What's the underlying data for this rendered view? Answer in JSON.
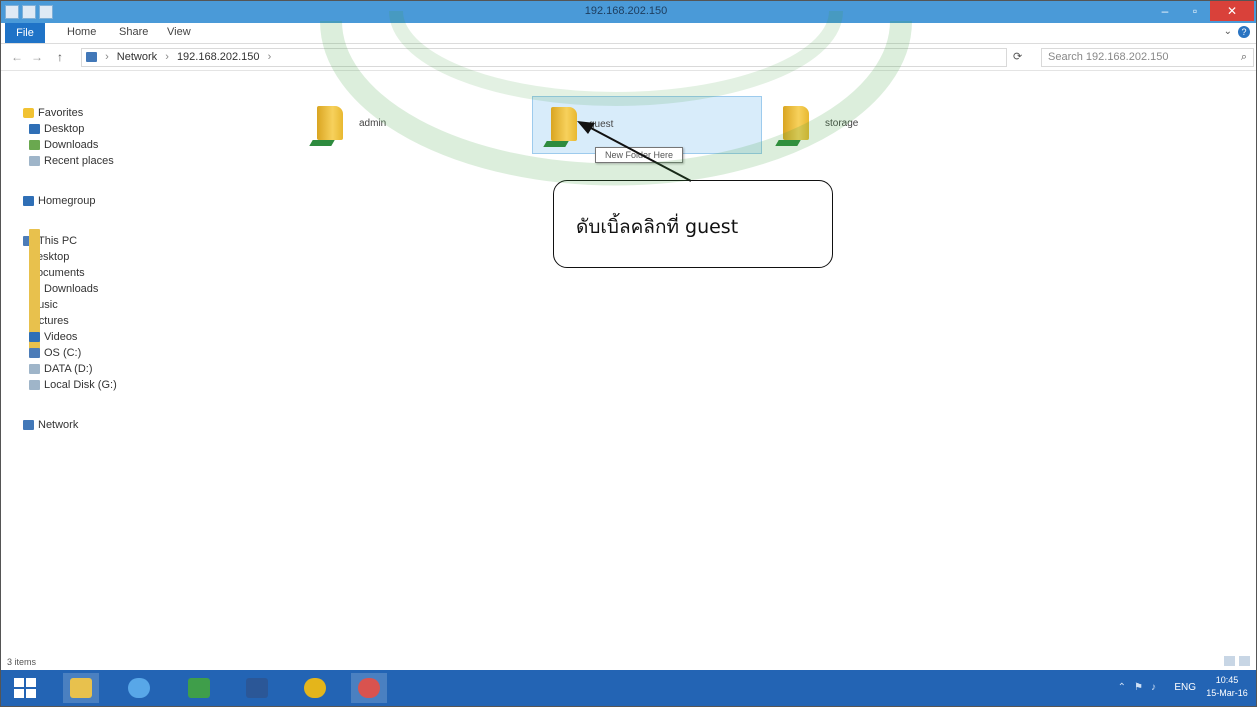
{
  "window": {
    "title": "192.168.202.150",
    "minimize_glyph": "–",
    "maximize_glyph": "▫",
    "close_glyph": "✕"
  },
  "ribbon": {
    "tabs": [
      "File",
      "Home",
      "Share",
      "View"
    ],
    "help_glyph": "?",
    "expand_glyph": "⌄"
  },
  "address_bar": {
    "back_glyph": "←",
    "forward_glyph": "→",
    "up_glyph": "↑",
    "path": [
      "Network",
      "192.168.202.150"
    ],
    "refresh_glyph": "⟳",
    "search_placeholder": "Search 192.168.202.150",
    "search_glyph": "⌕"
  },
  "nav_pane": {
    "favorites": {
      "label": "Favorites",
      "items": [
        "Desktop",
        "Downloads",
        "Recent places"
      ]
    },
    "homegroup": "Homegroup",
    "this_pc": {
      "label": "This PC",
      "items": [
        "Desktop",
        "Documents",
        "Downloads",
        "Music",
        "Pictures",
        "Videos",
        "OS (C:)",
        "DATA (D:)",
        "Local Disk (G:)"
      ]
    },
    "network": "Network"
  },
  "content": {
    "folders": [
      {
        "name": "admin",
        "selected": false
      },
      {
        "name": "guest",
        "selected": true
      },
      {
        "name": "storage",
        "selected": false
      }
    ],
    "tooltip": "New Folder Here"
  },
  "callout": {
    "text": "ดับเบิ้ลคลิกที่  guest"
  },
  "status_bar": {
    "item_count": "3 items"
  },
  "taskbar": {
    "tray_glyphs": [
      "⌃",
      "⚑",
      "♪"
    ],
    "language": "ENG",
    "time": "10:45",
    "date": "15-Mar-16"
  },
  "colors": {
    "title_bar": "#4a9ad8",
    "file_tab": "#1f73c7",
    "taskbar": "#2364b4",
    "close_button": "#d9413a",
    "watermark": "#3b9e3b",
    "selection": "#d8ecfa"
  },
  "icons": {
    "favorites": "star-icon",
    "homegroup": "homegroup-icon",
    "this_pc": "computer-icon",
    "network": "network-icon",
    "folder": "folder-icon"
  }
}
